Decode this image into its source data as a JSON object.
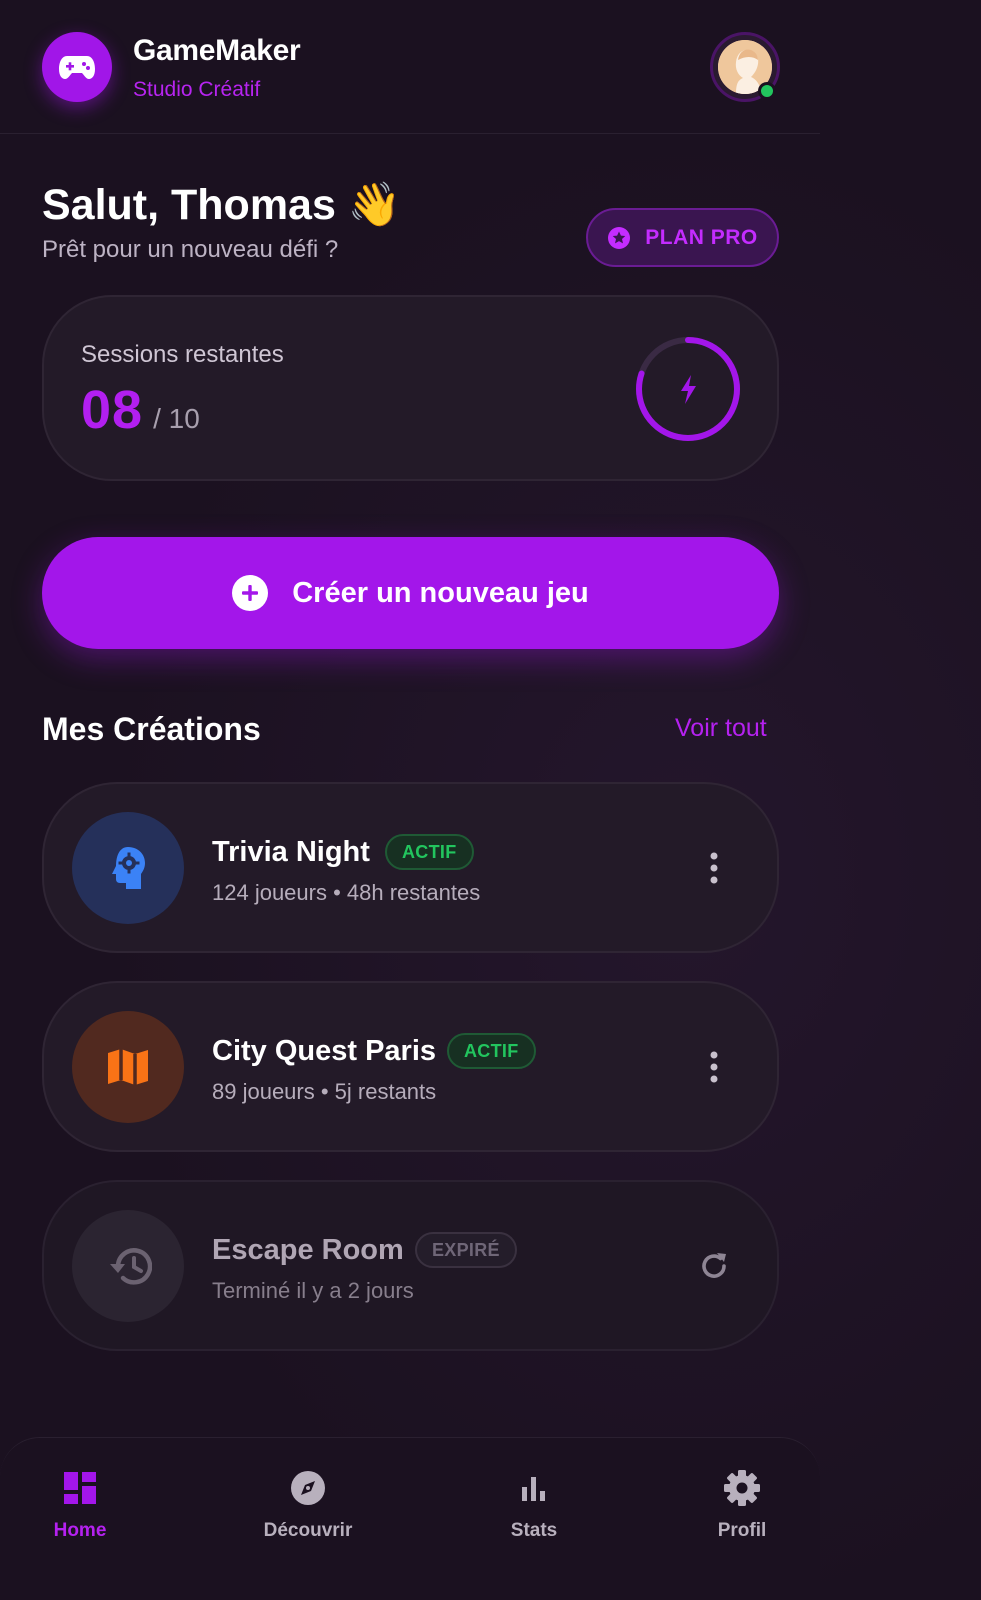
{
  "header": {
    "app_name": "GameMaker",
    "subtitle": "Studio Créatif",
    "logo_icon": "gamepad-icon",
    "avatar_status": "online"
  },
  "greeting": {
    "title": "Salut, Thomas 👋",
    "subtitle": "Prêt pour un nouveau défi ?",
    "plan_label": "PLAN PRO"
  },
  "sessions": {
    "label": "Sessions restantes",
    "remaining": "08",
    "total": "/ 10",
    "progress_fraction": 0.8
  },
  "cta": {
    "label": "Créer un nouveau jeu"
  },
  "creations": {
    "title": "Mes Créations",
    "see_all": "Voir tout",
    "items": [
      {
        "title": "Trivia Night",
        "badge": "ACTIF",
        "meta": "124 joueurs • 48h restantes",
        "icon": "brain-gear-icon",
        "status": "active",
        "action_icon": "more-vertical-icon"
      },
      {
        "title": "City Quest Paris",
        "badge": "ACTIF",
        "meta": "89 joueurs • 5j restants",
        "icon": "map-icon",
        "status": "active",
        "action_icon": "more-vertical-icon"
      },
      {
        "title": "Escape Room",
        "badge": "EXPIRÉ",
        "meta": "Terminé il y a 2 jours",
        "icon": "history-icon",
        "status": "expired",
        "action_icon": "refresh-icon"
      }
    ]
  },
  "nav": {
    "items": [
      {
        "label": "Home",
        "icon": "dashboard-icon",
        "active": true
      },
      {
        "label": "Découvrir",
        "icon": "compass-icon",
        "active": false
      },
      {
        "label": "Stats",
        "icon": "bar-chart-icon",
        "active": false
      },
      {
        "label": "Profil",
        "icon": "gear-icon",
        "active": false
      }
    ]
  },
  "colors": {
    "accent": "#a316ea",
    "background": "#1b1120",
    "card": "#231a28",
    "success": "#22c55e"
  }
}
